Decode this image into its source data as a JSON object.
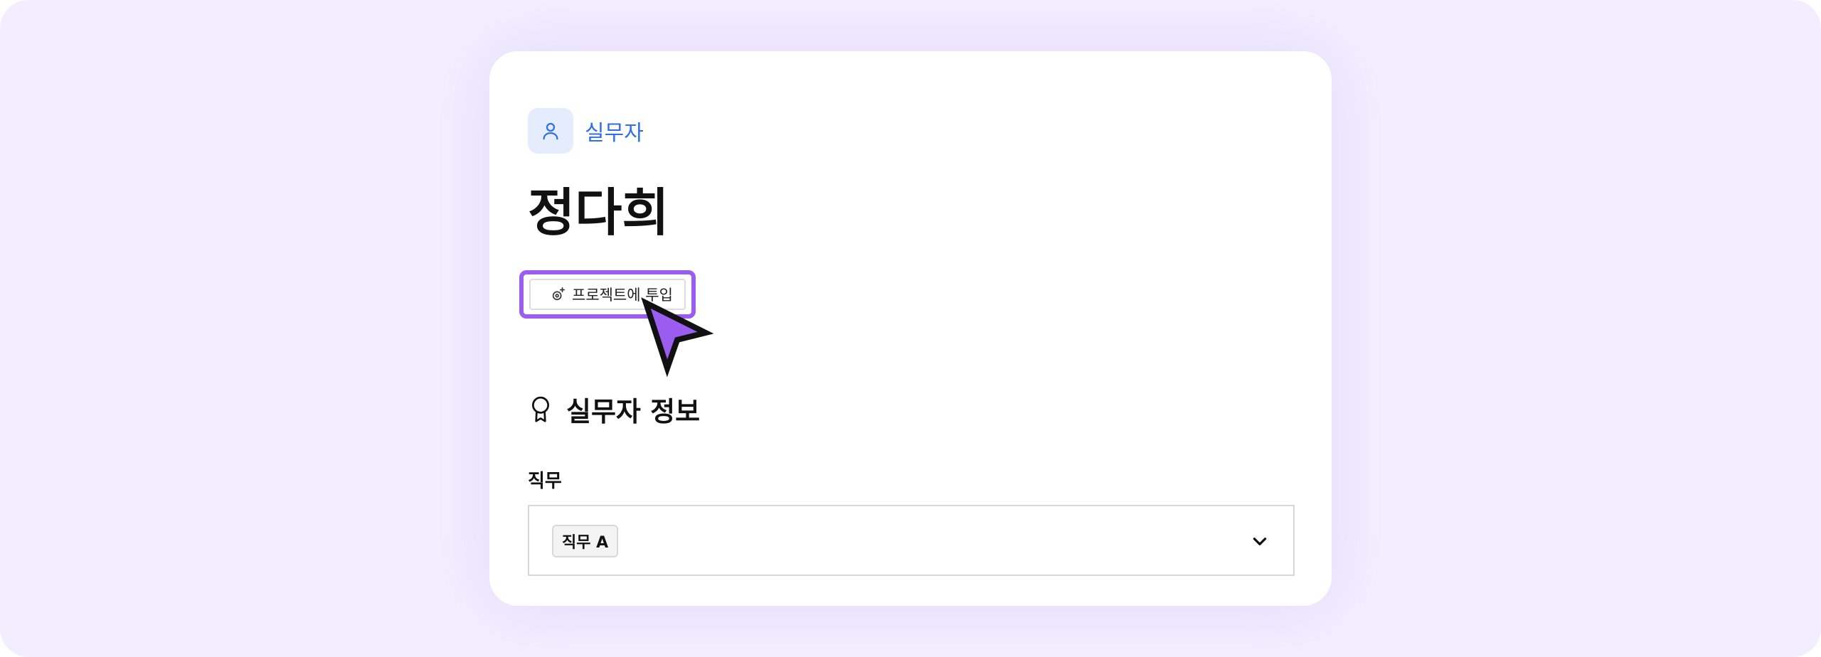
{
  "header": {
    "role_icon": "user-icon",
    "role_label": "실무자",
    "role_color": "#2f6ee8",
    "person_name": "정다희"
  },
  "actions": {
    "assign_icon": "sparkle-gear-icon",
    "assign_label": "프로젝트에 투입",
    "highlight_color": "#9a5df0"
  },
  "section": {
    "icon": "award-ribbon-icon",
    "title": "실무자 정보"
  },
  "job_field": {
    "label": "직무",
    "selected_value": "직무 A",
    "dropdown_icon": "chevron-down-icon"
  },
  "cursor": {
    "icon": "pointer-cursor-icon",
    "color": "#9a5df0"
  },
  "colors": {
    "background": "#f3eeff",
    "card": "#ffffff"
  }
}
